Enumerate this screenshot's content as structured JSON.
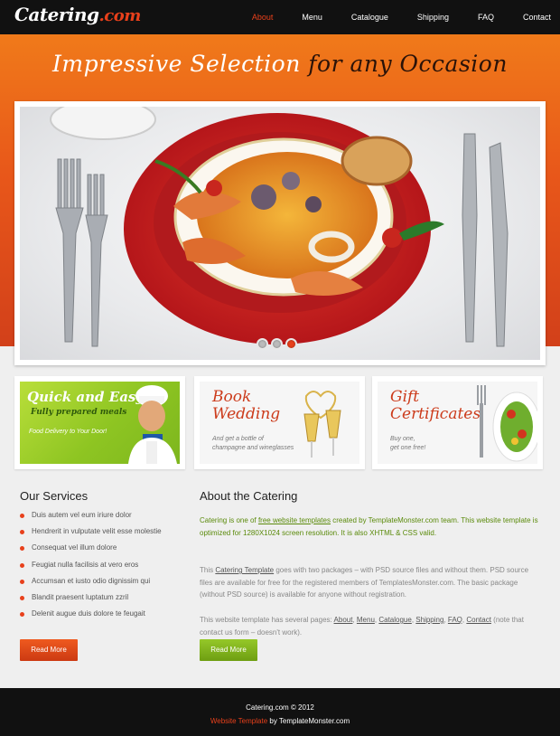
{
  "header": {
    "logo_main": "Catering",
    "logo_suffix": ".com",
    "nav": [
      {
        "label": "About",
        "active": true
      },
      {
        "label": "Menu",
        "active": false
      },
      {
        "label": "Catalogue",
        "active": false
      },
      {
        "label": "Shipping",
        "active": false
      },
      {
        "label": "FAQ",
        "active": false
      },
      {
        "label": "Contact",
        "active": false
      }
    ]
  },
  "hero": {
    "tagline_light": "Impressive Selection",
    "tagline_dark": "for any Occasion"
  },
  "slider": {
    "slide_count": 3,
    "active_index": 2,
    "image": "seafood-plate-photo"
  },
  "promos": [
    {
      "title": "Quick and Easy",
      "subtitle": "Fully prepared meals",
      "note": "Food Delivery to Your Door!",
      "image": "chef-photo"
    },
    {
      "title_1": "Book",
      "title_2": "Wedding",
      "note_1": "And get a bottle of",
      "note_2": "champagne and wineglasses",
      "image": "champagne-glasses-photo"
    },
    {
      "title_1": "Gift",
      "title_2": "Certificates",
      "note_1": "Buy one,",
      "note_2": "get one free!",
      "image": "salad-plate-photo"
    }
  ],
  "services": {
    "heading": "Our Services",
    "items": [
      "Duis autem vel eum iriure dolor",
      "Hendrerit in vulputate velit esse molestie",
      "Consequat vel illum dolore",
      "Feugiat nulla facilisis at vero eros",
      "Accumsan et iusto odio dignissim qui",
      "Blandit praesent luptatum zzril",
      "Delenit augue duis dolore te feugait"
    ],
    "button": "Read More"
  },
  "about": {
    "heading": "About the Catering",
    "lead_1": "Catering is one of ",
    "lead_link": "free website templates",
    "lead_2": " created by TemplateMonster.com team. This website template is optimized for 1280X1024 screen resolution. It is also XHTML & CSS valid.",
    "p2_1": "This ",
    "p2_link": "Catering Template",
    "p2_2": " goes with two packages – with PSD source files and without them. PSD source files are available for free for the registered members of TemplatesMonster.com. The basic package (without PSD source) is available for anyone without registration.",
    "p3_1": "This website template has several pages: ",
    "p3_links": [
      "About",
      "Menu",
      "Catalogue",
      "Shipping",
      "FAQ",
      "Contact"
    ],
    "p3_2": " (note that contact us form – doesn't work).",
    "button": "Read More"
  },
  "footer": {
    "copyright": "Catering.com © 2012",
    "template_link": "Website Template",
    "by_text": " by TemplateMonster.com"
  },
  "colors": {
    "accent": "#e8401b",
    "green": "#7cae16",
    "header_bg": "#111111"
  }
}
